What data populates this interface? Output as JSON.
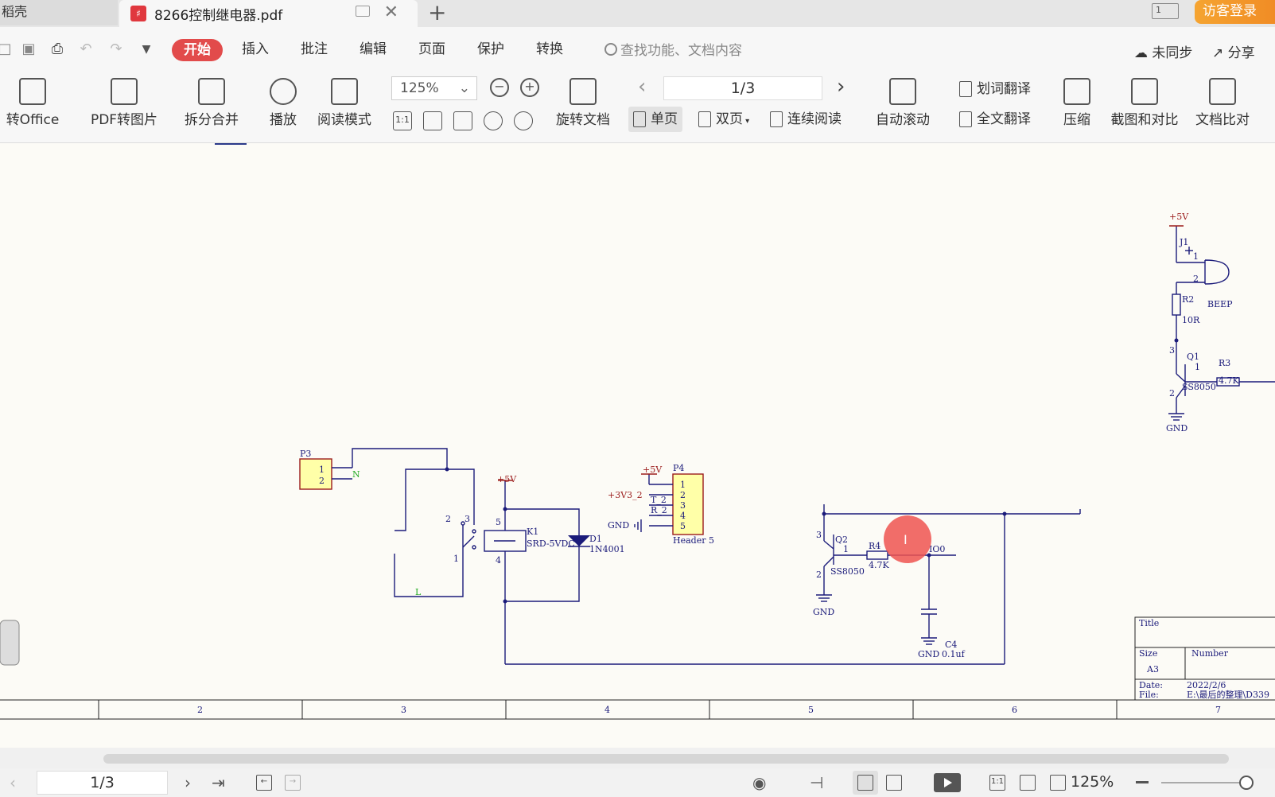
{
  "tabs": {
    "home_label": "稻壳",
    "doc_title": "8266控制继电器.pdf",
    "add_symbol": "+",
    "close_symbol": "✕",
    "guest_login": "访客登录",
    "window_indicator": "1"
  },
  "menu": {
    "active": "开始",
    "items": [
      "插入",
      "批注",
      "编辑",
      "页面",
      "保护",
      "转换"
    ],
    "search_placeholder": "查找功能、文档内容",
    "sync": "未同步",
    "share": "分享"
  },
  "ribbon": {
    "convert_office": "转Office",
    "pdf_to_image": "PDF转图片",
    "split_merge": "拆分合并",
    "play": "播放",
    "read_mode": "阅读模式",
    "zoom_level": "125%",
    "actual_size": "1:1",
    "rotate_doc": "旋转文档",
    "page_indicator": "1/3",
    "single_page": "单页",
    "double_page": "双页",
    "continuous": "连续阅读",
    "auto_scroll": "自动滚动",
    "word_translate": "划词翻译",
    "full_translate": "全文翻译",
    "compress": "压缩",
    "screenshot_compare": "截图和对比",
    "doc_compare": "文档比对"
  },
  "schematic": {
    "buzzer": {
      "vcc": "+5V",
      "j1": "J1",
      "pin1": "1",
      "pin2": "2",
      "beep": "BEEP",
      "r2": "R2",
      "r2_val": "10R",
      "q1": "Q1",
      "q1_type": "SS8050",
      "r3": "R3",
      "r3_val": "4.7K",
      "q1_b": "1",
      "q1_c": "3",
      "q1_e": "2",
      "gnd": "GND"
    },
    "p3": {
      "ref": "P3",
      "pin1": "1",
      "pin2": "2",
      "net_n": "N",
      "net_l": "L"
    },
    "relay": {
      "vcc": "+5V",
      "ref": "K1",
      "type": "SRD-5VDC",
      "pin5": "5",
      "pin4": "4",
      "pin1": "1",
      "pin2": "2",
      "pin3": "3",
      "d1": "D1",
      "d1_type": "1N4001"
    },
    "header": {
      "ref": "P4",
      "vcc": "+5V",
      "v33": "+3V3_2",
      "tx": "T_2",
      "rx": "R_2",
      "gnd": "GND",
      "pins": [
        "1",
        "2",
        "3",
        "4",
        "5"
      ],
      "name": "Header 5"
    },
    "driver": {
      "q2": "Q2",
      "q2_type": "SS8050",
      "r4": "R4",
      "r4_val": "4.7K",
      "io": "IO0",
      "c4": "C4",
      "c4_val": "0.1uf",
      "gnd": "GND",
      "q2_b": "1",
      "q2_c": "3",
      "q2_e": "2"
    },
    "title_block": {
      "title": "Title",
      "size": "Size",
      "size_val": "A3",
      "number": "Number",
      "date": "Date:",
      "date_val": "2022/2/6",
      "file": "File:",
      "file_val": "E:\\最后的整理\\D339"
    },
    "border_numbers": [
      "2",
      "3",
      "4",
      "5",
      "6",
      "7"
    ]
  },
  "statusbar": {
    "page": "1/3",
    "zoom": "125%",
    "actual_size": "1:1"
  }
}
